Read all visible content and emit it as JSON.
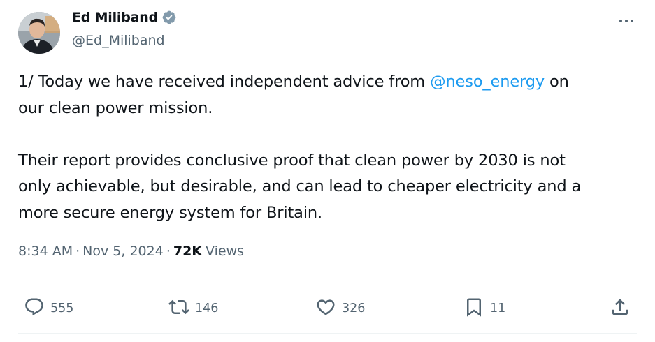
{
  "author": {
    "display_name": "Ed Miliband",
    "handle": "@Ed_Miliband",
    "verified": true
  },
  "tweet": {
    "text_part1": "1/ Today we have received independent advice from ",
    "mention": "@neso_energy",
    "text_part2": " on\nour clean power mission.\n\nTheir report provides conclusive proof that clean power by 2030 is not\nonly achievable, but desirable, and can lead to cheaper electricity and a\nmore secure energy system for Britain."
  },
  "meta": {
    "time": "8:34 AM",
    "separator": "·",
    "date": "Nov 5, 2024",
    "views_count": "72K",
    "views_label": "Views"
  },
  "actions": {
    "replies": "555",
    "reposts": "146",
    "likes": "326",
    "bookmarks": "11"
  },
  "icons": {
    "verified": "verified-badge-icon",
    "more": "more-dots-icon",
    "reply": "reply-icon",
    "repost": "repost-icon",
    "like": "heart-icon",
    "bookmark": "bookmark-icon",
    "share": "share-icon"
  },
  "colors": {
    "accent": "#1d9bf0",
    "text": "#0f1419",
    "secondary": "#536471",
    "verified_badge": "#829aab",
    "divider": "#eff3f4"
  }
}
